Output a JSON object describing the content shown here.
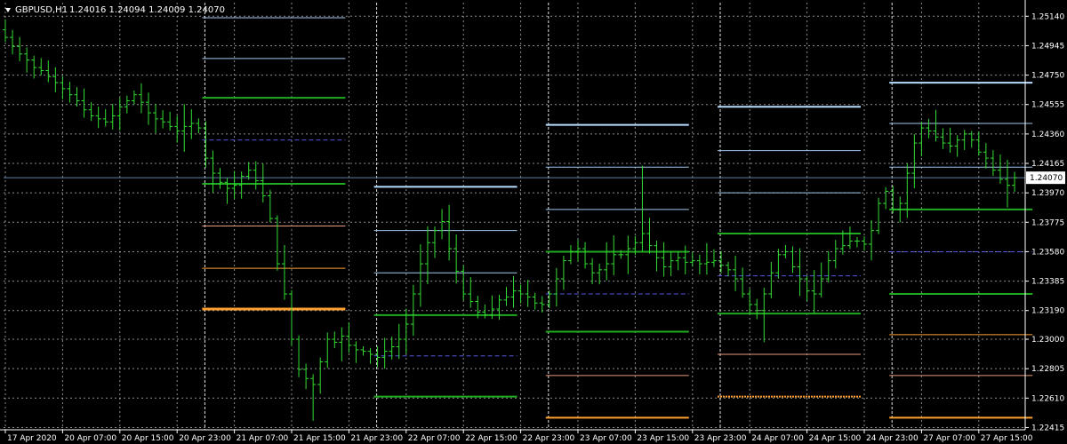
{
  "header": {
    "menu_icon": "triangle-down-icon",
    "symbol": "GBPUSD,H1",
    "ohlc": "1.24016 1.24094 1.24009 1.24070"
  },
  "colors": {
    "background": "#000000",
    "grid": "#c8c8c8",
    "candle": "#33dd33",
    "bid_line": "#5b7fa6",
    "price_label_bg": "#ffffff",
    "price_label_text": "#000000"
  },
  "chart_data": {
    "type": "ohlc-bars",
    "symbol": "GBPUSD",
    "timeframe": "H1",
    "title": "GBPUSD,H1",
    "ylim": [
      1.224,
      1.2523
    ],
    "y_ticks": [
      1.2514,
      1.24945,
      1.2475,
      1.24555,
      1.2436,
      1.24165,
      1.2397,
      1.23775,
      1.2358,
      1.23385,
      1.2319,
      1.23,
      1.22805,
      1.2261,
      1.22415
    ],
    "x_ticks": [
      {
        "bar": 0,
        "label": "17 Apr 2020"
      },
      {
        "bar": 8,
        "label": "20 Apr 07:00"
      },
      {
        "bar": 16,
        "label": "20 Apr 15:00"
      },
      {
        "bar": 24,
        "label": "20 Apr 23:00"
      },
      {
        "bar": 32,
        "label": "21 Apr 07:00"
      },
      {
        "bar": 40,
        "label": "21 Apr 15:00"
      },
      {
        "bar": 48,
        "label": "21 Apr 23:00"
      },
      {
        "bar": 56,
        "label": "22 Apr 07:00"
      },
      {
        "bar": 64,
        "label": "22 Apr 15:00"
      },
      {
        "bar": 72,
        "label": "22 Apr 23:00"
      },
      {
        "bar": 80,
        "label": "23 Apr 07:00"
      },
      {
        "bar": 88,
        "label": "23 Apr 15:00"
      },
      {
        "bar": 96,
        "label": "23 Apr 23:00"
      },
      {
        "bar": 104,
        "label": "24 Apr 07:00"
      },
      {
        "bar": 112,
        "label": "24 Apr 15:00"
      },
      {
        "bar": 120,
        "label": "24 Apr 23:00"
      },
      {
        "bar": 128,
        "label": "27 Apr 07:00"
      },
      {
        "bar": 136,
        "label": "27 Apr 15:00"
      }
    ],
    "session_separators": [
      28,
      52,
      76,
      100,
      124
    ],
    "current_price": 1.2407,
    "current_price_label": "1.24070",
    "grid": true,
    "closes": [
      1.25,
      1.2494,
      1.2489,
      1.2485,
      1.248,
      1.2478,
      1.2474,
      1.247,
      1.2466,
      1.2462,
      1.2458,
      1.2452,
      1.2448,
      1.2446,
      1.2444,
      1.2448,
      1.2454,
      1.2458,
      1.2462,
      1.2457,
      1.245,
      1.2446,
      1.2444,
      1.2441,
      1.2438,
      1.2441,
      1.2443,
      1.244,
      1.242,
      1.241,
      1.2404,
      1.24,
      1.2402,
      1.2408,
      1.2412,
      1.2405,
      1.2395,
      1.238,
      1.235,
      1.233,
      1.23,
      1.228,
      1.2274,
      1.227,
      1.2285,
      1.23,
      1.2298,
      1.2302,
      1.2296,
      1.2293,
      1.2292,
      1.229,
      1.2288,
      1.2292,
      1.2295,
      1.23,
      1.231,
      1.233,
      1.235,
      1.2364,
      1.2372,
      1.2378,
      1.236,
      1.2345,
      1.233,
      1.2325,
      1.2318,
      1.2316,
      1.232,
      1.2326,
      1.2328,
      1.2332,
      1.233,
      1.2328,
      1.2324,
      1.2323,
      1.233,
      1.234,
      1.2352,
      1.2358,
      1.236,
      1.235,
      1.2344,
      1.2346,
      1.235,
      1.2356,
      1.2356,
      1.236,
      1.2364,
      1.237,
      1.2362,
      1.2354,
      1.2348,
      1.2352,
      1.2354,
      1.2351,
      1.2352,
      1.235,
      1.2351,
      1.2352,
      1.2349,
      1.2346,
      1.234,
      1.233,
      1.2323,
      1.2319,
      1.233,
      1.2344,
      1.2356,
      1.2358,
      1.2348,
      1.234,
      1.2332,
      1.233,
      1.234,
      1.2352,
      1.236,
      1.2362,
      1.2365,
      1.2365,
      1.2363,
      1.2372,
      1.239,
      1.2398,
      1.2386,
      1.239,
      1.241,
      1.243,
      1.244,
      1.2438,
      1.2434,
      1.243,
      1.2428,
      1.2432,
      1.2436,
      1.2432,
      1.2424,
      1.242,
      1.2412,
      1.2406,
      1.2402,
      1.2407
    ]
  },
  "levels": [
    {
      "from": 28,
      "to": 48,
      "price": 1.2513,
      "color": "#9fc8ec",
      "width": 1,
      "dash": ""
    },
    {
      "from": 28,
      "to": 48,
      "price": 1.2486,
      "color": "#9fc8ec",
      "width": 1,
      "dash": ""
    },
    {
      "from": 28,
      "to": 48,
      "price": 1.246,
      "color": "#22aa22",
      "width": 2,
      "dash": ""
    },
    {
      "from": 28,
      "to": 48,
      "price": 1.2432,
      "color": "#5555dd",
      "width": 1,
      "dash": "5,3"
    },
    {
      "from": 28,
      "to": 48,
      "price": 1.2403,
      "color": "#22aa22",
      "width": 2,
      "dash": ""
    },
    {
      "from": 28,
      "to": 48,
      "price": 1.2375,
      "color": "#e89a7a",
      "width": 1,
      "dash": ""
    },
    {
      "from": 28,
      "to": 48,
      "price": 1.2347,
      "color": "#ffa030",
      "width": 1,
      "dash": ""
    },
    {
      "from": 28,
      "to": 48,
      "price": 1.232,
      "color": "#ffa030",
      "width": 3,
      "dash": ""
    },
    {
      "from": 52,
      "to": 72,
      "price": 1.2401,
      "color": "#b8dcff",
      "width": 2,
      "dash": ""
    },
    {
      "from": 52,
      "to": 72,
      "price": 1.2372,
      "color": "#9fc8ec",
      "width": 1,
      "dash": ""
    },
    {
      "from": 52,
      "to": 72,
      "price": 1.2344,
      "color": "#9fc8ec",
      "width": 1,
      "dash": ""
    },
    {
      "from": 52,
      "to": 72,
      "price": 1.2316,
      "color": "#22aa22",
      "width": 2,
      "dash": ""
    },
    {
      "from": 52,
      "to": 72,
      "price": 1.2289,
      "color": "#5555dd",
      "width": 1,
      "dash": "5,3"
    },
    {
      "from": 52,
      "to": 72,
      "price": 1.2262,
      "color": "#22aa22",
      "width": 2,
      "dash": ""
    },
    {
      "from": 76,
      "to": 96,
      "price": 1.2442,
      "color": "#b8dcff",
      "width": 2,
      "dash": ""
    },
    {
      "from": 76,
      "to": 96,
      "price": 1.2414,
      "color": "#9fc8ec",
      "width": 1,
      "dash": ""
    },
    {
      "from": 76,
      "to": 96,
      "price": 1.2386,
      "color": "#9fc8ec",
      "width": 1,
      "dash": ""
    },
    {
      "from": 76,
      "to": 96,
      "price": 1.2358,
      "color": "#22aa22",
      "width": 2,
      "dash": ""
    },
    {
      "from": 76,
      "to": 96,
      "price": 1.233,
      "color": "#5555dd",
      "width": 1,
      "dash": "5,3"
    },
    {
      "from": 76,
      "to": 96,
      "price": 1.2305,
      "color": "#22aa22",
      "width": 2,
      "dash": ""
    },
    {
      "from": 76,
      "to": 96,
      "price": 1.2276,
      "color": "#e89a7a",
      "width": 1,
      "dash": ""
    },
    {
      "from": 76,
      "to": 96,
      "price": 1.2248,
      "color": "#ffa030",
      "width": 2,
      "dash": ""
    },
    {
      "from": 100,
      "to": 120,
      "price": 1.2454,
      "color": "#b8dcff",
      "width": 2,
      "dash": ""
    },
    {
      "from": 100,
      "to": 120,
      "price": 1.2425,
      "color": "#9fc8ec",
      "width": 1,
      "dash": ""
    },
    {
      "from": 100,
      "to": 120,
      "price": 1.2397,
      "color": "#9fc8ec",
      "width": 1,
      "dash": ""
    },
    {
      "from": 100,
      "to": 120,
      "price": 1.237,
      "color": "#22aa22",
      "width": 2,
      "dash": ""
    },
    {
      "from": 100,
      "to": 120,
      "price": 1.2342,
      "color": "#5555dd",
      "width": 1,
      "dash": "5,3"
    },
    {
      "from": 100,
      "to": 120,
      "price": 1.2317,
      "color": "#22aa22",
      "width": 2,
      "dash": ""
    },
    {
      "from": 100,
      "to": 120,
      "price": 1.229,
      "color": "#e89a7a",
      "width": 1,
      "dash": ""
    },
    {
      "from": 100,
      "to": 120,
      "price": 1.2262,
      "color": "#ffa030",
      "width": 2,
      "dash": "2,1"
    },
    {
      "from": 124,
      "to": 144,
      "price": 1.247,
      "color": "#b8dcff",
      "width": 2,
      "dash": ""
    },
    {
      "from": 124,
      "to": 144,
      "price": 1.2443,
      "color": "#9fc8ec",
      "width": 1,
      "dash": ""
    },
    {
      "from": 124,
      "to": 144,
      "price": 1.2414,
      "color": "#9fc8ec",
      "width": 1,
      "dash": ""
    },
    {
      "from": 124,
      "to": 144,
      "price": 1.2386,
      "color": "#22aa22",
      "width": 2,
      "dash": ""
    },
    {
      "from": 124,
      "to": 144,
      "price": 1.2358,
      "color": "#5555dd",
      "width": 1,
      "dash": "5,3"
    },
    {
      "from": 124,
      "to": 144,
      "price": 1.233,
      "color": "#22aa22",
      "width": 2,
      "dash": ""
    },
    {
      "from": 124,
      "to": 144,
      "price": 1.2303,
      "color": "#ffa030",
      "width": 1,
      "dash": ""
    },
    {
      "from": 124,
      "to": 144,
      "price": 1.2276,
      "color": "#e89a7a",
      "width": 1,
      "dash": ""
    },
    {
      "from": 124,
      "to": 144,
      "price": 1.2248,
      "color": "#ffa030",
      "width": 2,
      "dash": ""
    }
  ]
}
